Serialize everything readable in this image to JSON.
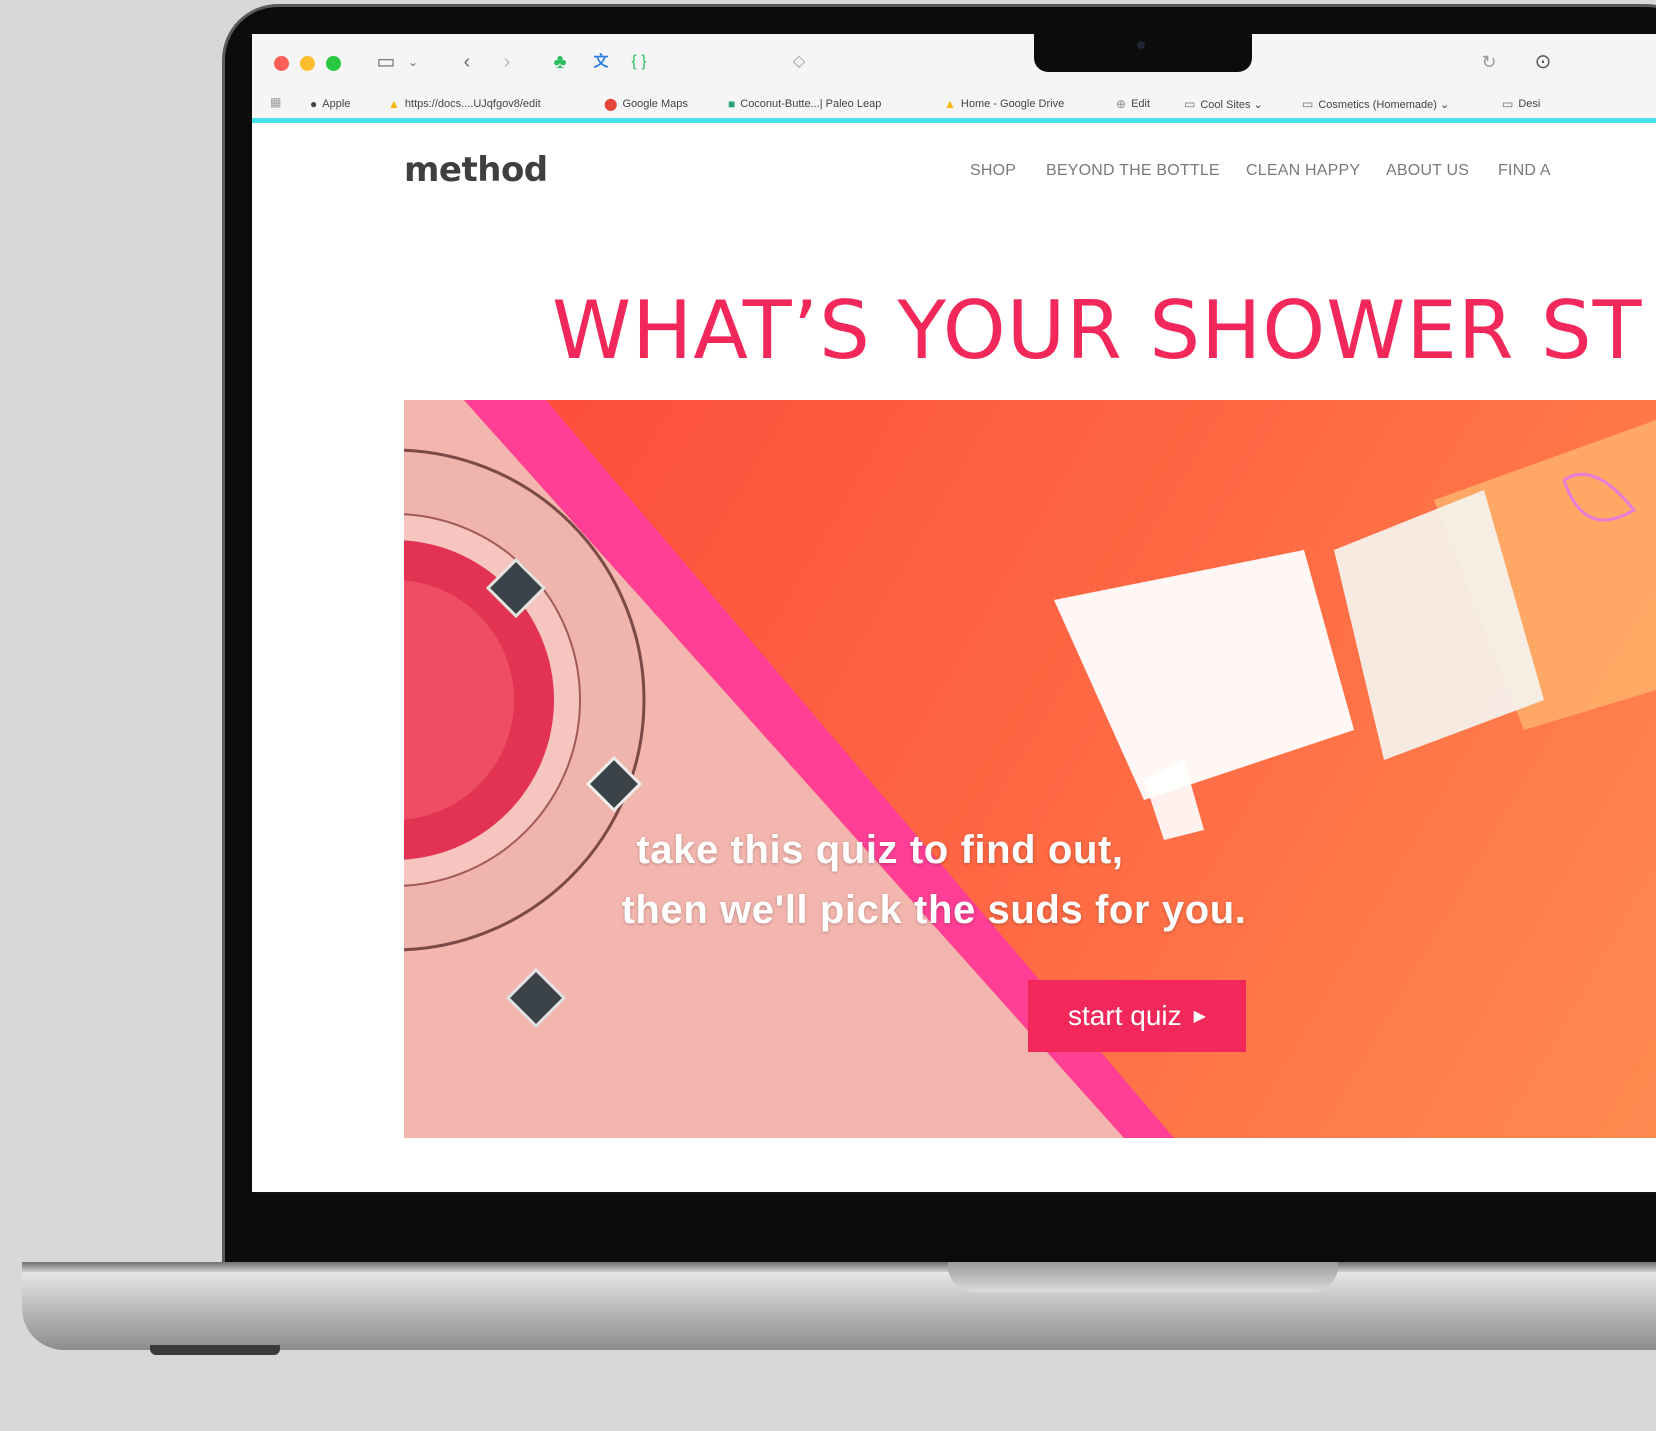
{
  "browser": {
    "bookmarks": [
      {
        "icon": "apple-icon",
        "glyph": "",
        "label": "Apple"
      },
      {
        "icon": "google-drive-icon",
        "glyph": "▲",
        "label": "https://docs....UJqfgov8/edit"
      },
      {
        "icon": "google-maps-icon",
        "glyph": "⬤",
        "label": "Google Maps"
      },
      {
        "icon": "paleo-leap-icon",
        "glyph": "■",
        "label": "Coconut-Butte...| Paleo Leap"
      },
      {
        "icon": "google-drive-icon",
        "glyph": "▲",
        "label": "Home - Google Drive"
      },
      {
        "icon": "globe-icon",
        "glyph": "⊕",
        "label": "Edit"
      },
      {
        "icon": "folder-icon",
        "glyph": "▭",
        "label": "Cool Sites ⌄"
      },
      {
        "icon": "folder-icon",
        "glyph": "▭",
        "label": "Cosmetics (Homemade) ⌄"
      },
      {
        "icon": "folder-icon",
        "glyph": "▭",
        "label": "Desi"
      }
    ]
  },
  "site": {
    "logo": "method",
    "nav": [
      "SHOP",
      "BEYOND THE BOTTLE",
      "CLEAN HAPPY",
      "ABOUT US",
      "FIND A"
    ],
    "headline": "WHAT’S YOUR SHOWER ST",
    "tagline_1": "take this quiz to find out,",
    "tagline_2": "then we'll pick the suds for you.",
    "cta": "start quiz",
    "cta_icon": "▶"
  },
  "colors": {
    "brand_pink": "#f2285a",
    "hero_orange": "#fb4a3a",
    "accent_cyan": "#46e1ea"
  }
}
